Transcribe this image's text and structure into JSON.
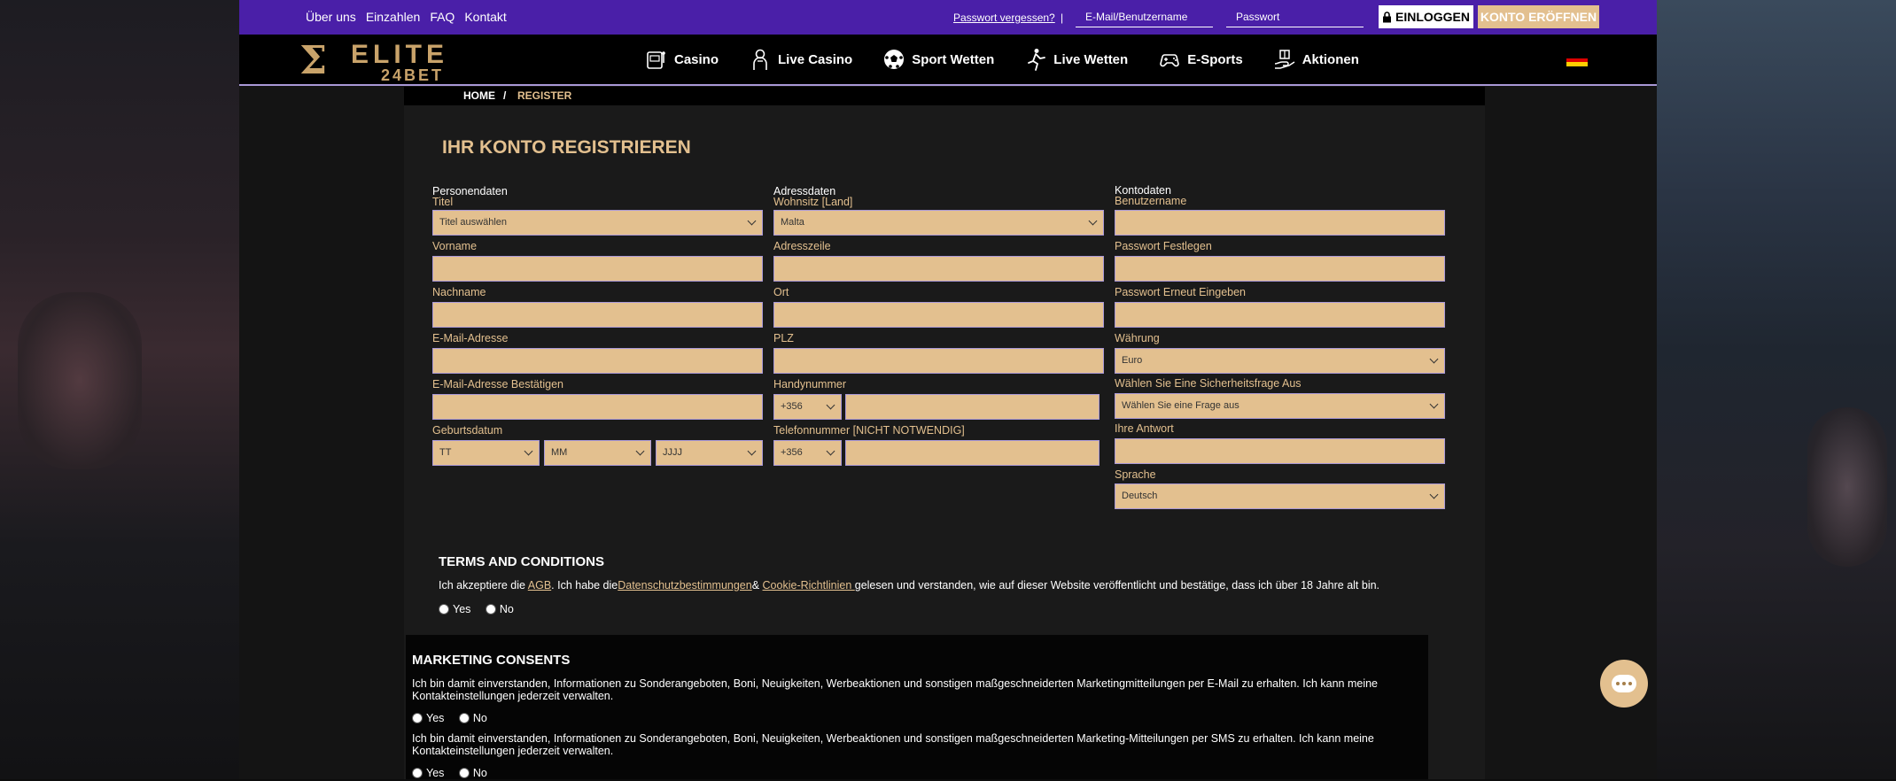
{
  "colors": {
    "accent": "#e3c08f",
    "topbar": "#4a1fa8",
    "border": "#a998d6"
  },
  "topbar": {
    "links": [
      "Über uns",
      "Einzahlen",
      "FAQ",
      "Kontakt"
    ],
    "forgot": "Passwort vergessen?",
    "separator": "|",
    "email_placeholder": "E-Mail/Benutzername",
    "password_placeholder": "Passwort",
    "login": "EINLOGGEN",
    "open_account": "KONTO ERÖFFNEN"
  },
  "logo": {
    "mark": "Σ",
    "line1": "ELITE",
    "line2": "24BET"
  },
  "nav": [
    {
      "label": "Casino",
      "icon": "slot-machine-icon"
    },
    {
      "label": "Live Casino",
      "icon": "dealer-icon"
    },
    {
      "label": "Sport Wetten",
      "icon": "soccer-ball-icon"
    },
    {
      "label": "Live Wetten",
      "icon": "runner-icon"
    },
    {
      "label": "E-Sports",
      "icon": "gamepad-icon"
    },
    {
      "label": "Aktionen",
      "icon": "gift-hand-icon"
    }
  ],
  "language_flag": "germany-flag-icon",
  "breadcrumb": {
    "home": "HOME",
    "sep": "/",
    "current": "REGISTER"
  },
  "page_title": "IHR KONTO REGISTRIEREN",
  "form": {
    "personal": {
      "section": "Personendaten",
      "title_label": "Titel",
      "title_value": "Titel auswählen",
      "firstname_label": "Vorname",
      "lastname_label": "Nachname",
      "email_label": "E-Mail-Adresse",
      "email_confirm_label": "E-Mail-Adresse Bestätigen",
      "dob_label": "Geburtsdatum",
      "dob_day": "TT",
      "dob_month": "MM",
      "dob_year": "JJJJ"
    },
    "address": {
      "section": "Adressdaten",
      "country_label": "Wohnsitz [Land]",
      "country_value": "Malta",
      "address_label": "Adresszeile",
      "city_label": "Ort",
      "zip_label": "PLZ",
      "mobile_label": "Handynummer",
      "mobile_prefix": "+356",
      "phone_label": "Telefonnummer [NICHT NOTWENDIG]",
      "phone_prefix": "+356"
    },
    "account": {
      "section": "Kontodaten",
      "username_label": "Benutzername",
      "password_label": "Passwort Festlegen",
      "password_repeat_label": "Passwort Erneut Eingeben",
      "currency_label": "Währung",
      "currency_value": "Euro",
      "question_label": "Wählen Sie Eine Sicherheitsfrage Aus",
      "question_value": "Wählen Sie eine Frage aus",
      "answer_label": "Ihre Antwort",
      "language_label": "Sprache",
      "language_value": "Deutsch"
    }
  },
  "terms": {
    "title": "TERMS AND CONDITIONS",
    "t1": "Ich akzeptiere die ",
    "agb": "AGB",
    "t2": ". Ich habe die",
    "privacy": "Datenschutzbestimmungen",
    "t3": "& ",
    "cookies": "Cookie-Richtlinien ",
    "t4": "gelesen und verstanden, wie auf dieser Website veröffentlicht und bestätige, dass ich über 18 Jahre alt bin.",
    "yes": "Yes",
    "no": "No"
  },
  "marketing": {
    "title": "MARKETING CONSENTS",
    "email_text": "Ich bin damit einverstanden, Informationen zu Sonderangeboten, Boni, Neuigkeiten, Werbeaktionen und sonstigen maßgeschneiderten Marketingmitteilungen per E-Mail zu erhalten. Ich kann meine Kontakteinstellungen jederzeit verwalten.",
    "sms_text": "Ich bin damit einverstanden, Informationen zu Sonderangeboten, Boni, Neuigkeiten, Werbeaktionen und sonstigen maßgeschneiderten Marketing-Mitteilungen per SMS zu erhalten. Ich kann meine Kontakteinstellungen jederzeit verwalten.",
    "yes": "Yes",
    "no": "No"
  }
}
